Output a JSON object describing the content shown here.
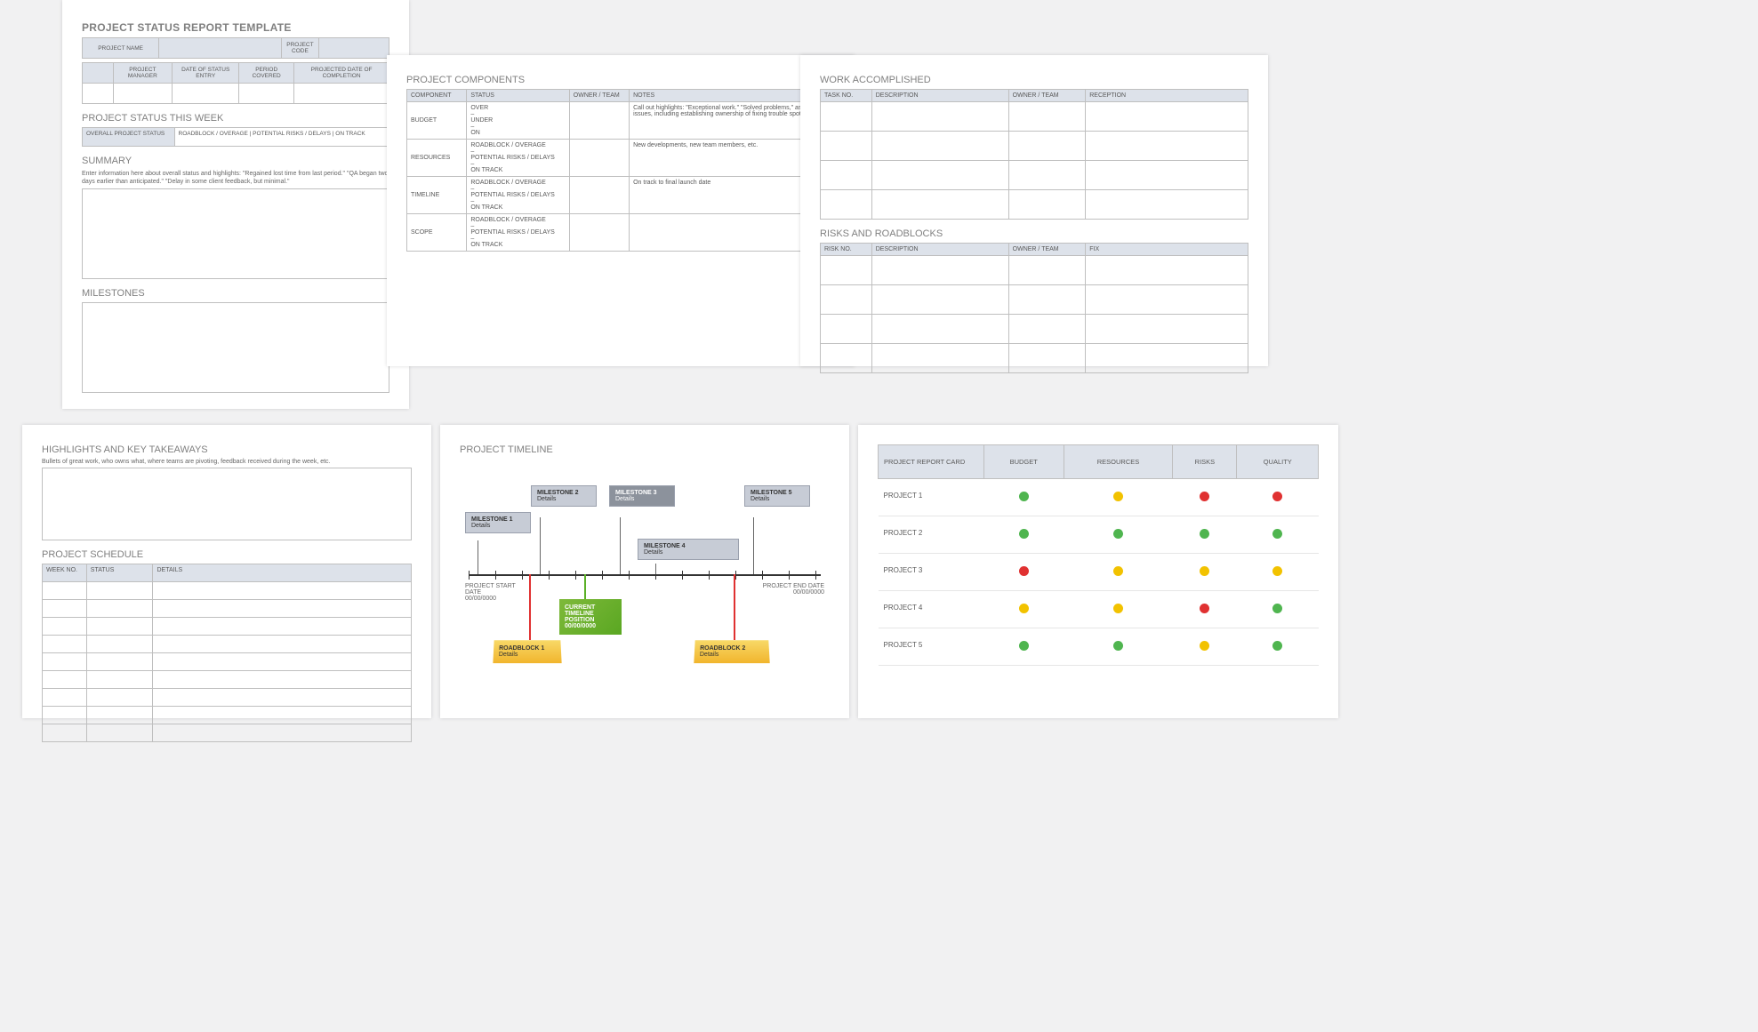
{
  "page1": {
    "title": "PROJECT STATUS REPORT TEMPLATE",
    "row1": {
      "name": "PROJECT NAME",
      "code": "PROJECT CODE"
    },
    "row2": {
      "pm": "PROJECT MANAGER",
      "date": "DATE OF STATUS ENTRY",
      "period": "PERIOD COVERED",
      "projected": "PROJECTED DATE OF COMPLETION"
    },
    "statusWeek": "PROJECT STATUS THIS WEEK",
    "statusRow": {
      "label": "OVERALL PROJECT STATUS",
      "opts": "ROADBLOCK / OVERAGE   |   POTENTIAL RISKS / DELAYS   |   ON TRACK"
    },
    "summary": {
      "title": "SUMMARY",
      "hint": "Enter information here about overall status and highlights: \"Regained lost time from last period.\" \"QA began two days earlier than anticipated.\" \"Delay in some client feedback, but minimal.\""
    },
    "milestones": "MILESTONES"
  },
  "page2": {
    "title": "PROJECT COMPONENTS",
    "headers": [
      "COMPONENT",
      "STATUS",
      "OWNER / TEAM",
      "NOTES"
    ],
    "rows": [
      {
        "comp": "BUDGET",
        "status": "OVER\n–\nUNDER\n–\nON",
        "note": "Call out highlights: \"Exceptional work.\" \"Solved problems,\" as well as issues, including establishing ownership of fixing trouble spots."
      },
      {
        "comp": "RESOURCES",
        "status": "ROADBLOCK / OVERAGE\n–\nPOTENTIAL RISKS / DELAYS\n–\nON TRACK",
        "note": "New developments, new team members, etc."
      },
      {
        "comp": "TIMELINE",
        "status": "ROADBLOCK / OVERAGE\n–\nPOTENTIAL RISKS / DELAYS\n–\nON TRACK",
        "note": "On track to final launch date"
      },
      {
        "comp": "SCOPE",
        "status": "ROADBLOCK / OVERAGE\n–\nPOTENTIAL RISKS / DELAYS\n–\nON TRACK",
        "note": ""
      }
    ]
  },
  "page3": {
    "work": {
      "title": "WORK ACCOMPLISHED",
      "headers": [
        "TASK NO.",
        "DESCRIPTION",
        "OWNER / TEAM",
        "RECEPTION"
      ]
    },
    "risks": {
      "title": "RISKS AND ROADBLOCKS",
      "headers": [
        "RISK NO.",
        "DESCRIPTION",
        "OWNER / TEAM",
        "FIX"
      ]
    }
  },
  "page4": {
    "highlights": {
      "title": "HIGHLIGHTS AND KEY TAKEAWAYS",
      "hint": "Bullets of great work, who owns what, where teams are pivoting, feedback received during the week, etc."
    },
    "schedule": {
      "title": "PROJECT SCHEDULE",
      "headers": [
        "WEEK NO.",
        "STATUS",
        "DETAILS"
      ]
    }
  },
  "page5": {
    "title": "PROJECT TIMELINE",
    "start": {
      "label": "PROJECT START DATE",
      "date": "00/00/0000"
    },
    "end": {
      "label": "PROJECT END DATE",
      "date": "00/00/0000"
    },
    "milestones": [
      {
        "t": "MILESTONE 1",
        "d": "Details"
      },
      {
        "t": "MILESTONE 2",
        "d": "Details"
      },
      {
        "t": "MILESTONE 3",
        "d": "Details"
      },
      {
        "t": "MILESTONE 4",
        "d": "Details"
      },
      {
        "t": "MILESTONE 5",
        "d": "Details"
      }
    ],
    "current": "CURRENT TIMELINE POSITION 00/00/0000",
    "roadblocks": [
      {
        "t": "ROADBLOCK 1",
        "d": "Details"
      },
      {
        "t": "ROADBLOCK 2",
        "d": "Details"
      }
    ]
  },
  "page6": {
    "headers": [
      "PROJECT REPORT CARD",
      "BUDGET",
      "RESOURCES",
      "RISKS",
      "QUALITY"
    ],
    "rows": [
      {
        "name": "PROJECT 1",
        "dots": [
          "g",
          "y",
          "r",
          "r"
        ]
      },
      {
        "name": "PROJECT 2",
        "dots": [
          "g",
          "g",
          "g",
          "g"
        ]
      },
      {
        "name": "PROJECT 3",
        "dots": [
          "r",
          "y",
          "y",
          "y"
        ]
      },
      {
        "name": "PROJECT 4",
        "dots": [
          "y",
          "y",
          "r",
          "g"
        ]
      },
      {
        "name": "PROJECT 5",
        "dots": [
          "g",
          "g",
          "y",
          "g"
        ]
      }
    ]
  }
}
